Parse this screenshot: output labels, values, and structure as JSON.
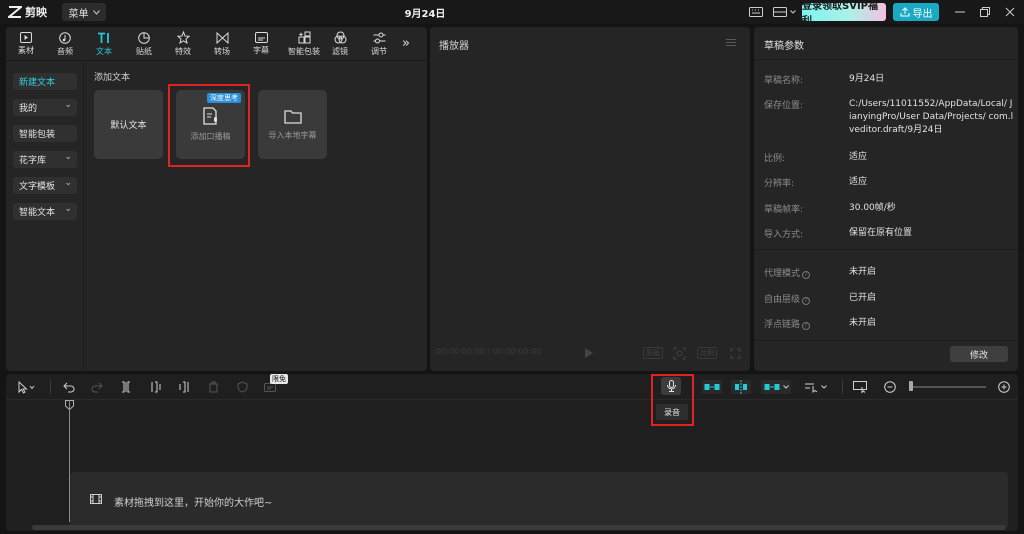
{
  "app": {
    "name": "剪映",
    "menu_label": "菜单",
    "project_title": "9月24日",
    "vip_label": "登录领取SVIP福利",
    "export_label": "导出"
  },
  "media_tabs": [
    {
      "label": "素材",
      "icon": "media-icon"
    },
    {
      "label": "音频",
      "icon": "audio-icon"
    },
    {
      "label": "文本",
      "icon": "text-icon",
      "active": true
    },
    {
      "label": "贴纸",
      "icon": "sticker-icon"
    },
    {
      "label": "特效",
      "icon": "effects-icon"
    },
    {
      "label": "转场",
      "icon": "transition-icon"
    },
    {
      "label": "字幕",
      "icon": "subtitle-icon"
    },
    {
      "label": "智能包装",
      "icon": "smart-pack-icon"
    },
    {
      "label": "滤镜",
      "icon": "filter-icon"
    },
    {
      "label": "调节",
      "icon": "adjust-icon"
    }
  ],
  "text_sidebar": [
    {
      "label": "新建文本",
      "active": true
    },
    {
      "label": "我的",
      "dropdown": true
    },
    {
      "label": "智能包装"
    },
    {
      "label": "花字库",
      "dropdown": true
    },
    {
      "label": "文字模板",
      "dropdown": true
    },
    {
      "label": "智能文本",
      "dropdown": true
    }
  ],
  "text_panel": {
    "section_title": "添加文本",
    "cards": [
      {
        "label": "默认文本"
      },
      {
        "label": "添加口播稿",
        "badge": "深度思考",
        "icon": "script-icon"
      },
      {
        "label": "导入本地字幕",
        "icon": "folder-icon"
      }
    ]
  },
  "player": {
    "title": "播放器",
    "time": "00:00:00:00 / 00:00:00:00",
    "ratio_label": "比例",
    "fit_label": "原画"
  },
  "properties": {
    "title": "草稿参数",
    "rows": [
      {
        "key": "草稿名称:",
        "value": "9月24日"
      },
      {
        "key": "保存位置:",
        "value": "C:/Users/11011552/AppData/Local/ JianyingPro/User Data/Projects/ com.lveditor.draft/9月24日"
      },
      {
        "key": "比例:",
        "value": "适应"
      },
      {
        "key": "分辨率:",
        "value": "适应"
      },
      {
        "key": "草稿帧率:",
        "value": "30.00帧/秒"
      },
      {
        "key": "导入方式:",
        "value": "保留在原有位置"
      },
      {
        "key": "代理模式",
        "value": "未开启"
      },
      {
        "key": "自由层级",
        "value": "已开启"
      },
      {
        "key": "浮点链路",
        "value": "未开启"
      }
    ],
    "edit_label": "修改"
  },
  "timeline": {
    "free_badge": "限免",
    "record_tooltip": "录音",
    "drop_hint": "素材拖拽到这里，开始你的大作吧~"
  },
  "colors": {
    "accent": "#27c8d8",
    "highlight": "#e02424",
    "export": "#1aa9c2"
  }
}
